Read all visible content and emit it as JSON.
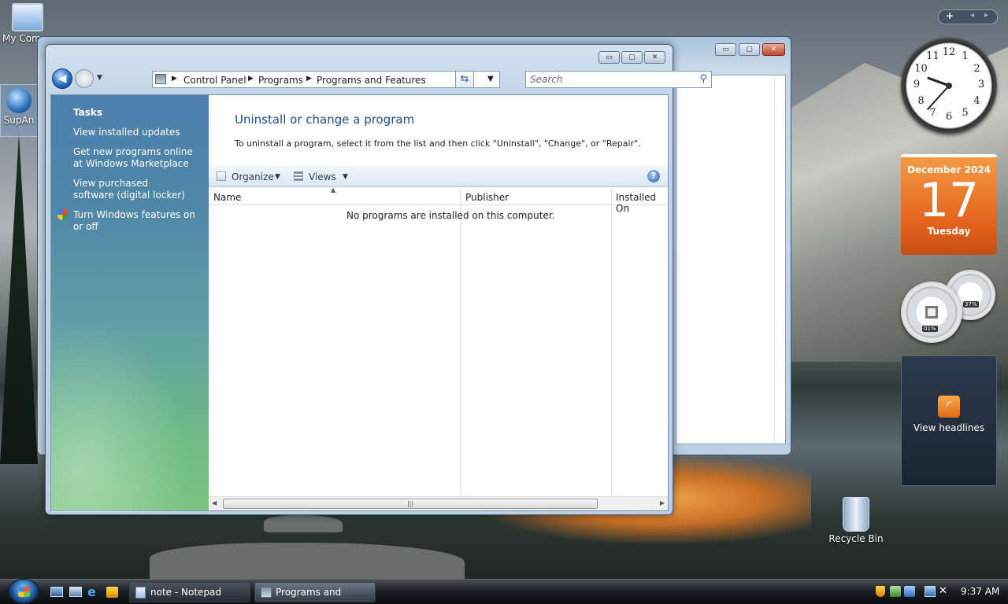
{
  "desktop": {
    "icons": [
      {
        "label": "My Compu",
        "icon": "computer-icon"
      },
      {
        "label": "SupAn",
        "icon": "shortcut-icon"
      },
      {
        "label": "Recycle Bin",
        "icon": "recycle-bin-icon"
      }
    ]
  },
  "window": {
    "title": "Programs and Features",
    "caption_buttons": {
      "minimize": "▭",
      "maximize": "▢",
      "close": "✕"
    },
    "nav": {
      "back": "back-arrow-icon",
      "forward": "forward-arrow-icon"
    },
    "breadcrumb": [
      "Control Panel",
      "Programs",
      "Programs and Features"
    ],
    "search_placeholder": "Search",
    "tasks": {
      "heading": "Tasks",
      "items": [
        "View installed updates",
        "Get new programs online at Windows Marketplace",
        "View purchased software (digital locker)",
        "Turn Windows features on or off"
      ]
    },
    "main_title": "Uninstall or change a program",
    "instructions": "To uninstall a program, select it from the list and then click \"Uninstall\", \"Change\", or \"Repair\".",
    "toolbar": {
      "organize": "Organize",
      "views": "Views"
    },
    "columns": [
      "Name",
      "Publisher",
      "Installed On"
    ],
    "empty_message": "No programs are installed on this computer.",
    "scroll_grip": "|||"
  },
  "gadgets": {
    "calendar": {
      "month_year": "December 2024",
      "day": "17",
      "weekday": "Tuesday"
    },
    "clock_numbers": [
      "12",
      "1",
      "2",
      "3",
      "4",
      "5",
      "6",
      "7",
      "8",
      "9",
      "10",
      "11"
    ],
    "cpu_meter": {
      "cpu": "01%",
      "mem": "37%"
    },
    "feed": {
      "label": "View headlines"
    },
    "sidebar_controls": {
      "add": "+",
      "prev": "◂",
      "next": "▸"
    }
  },
  "taskbar": {
    "buttons": [
      {
        "label": "note - Notepad",
        "icon": "notepad-icon"
      },
      {
        "label": "Programs and Featu...",
        "icon": "control-panel-icon"
      }
    ],
    "quick_launch": [
      "show-desktop-icon",
      "switch-windows-icon",
      "internet-explorer-icon",
      "media-player-icon"
    ],
    "clock": "9:37 AM"
  },
  "colors": {
    "accent": "#1d4e8f",
    "taskpane_top": "#4d7fae",
    "taskpane_bottom": "#79c57f",
    "calendar": "#e3611c"
  }
}
